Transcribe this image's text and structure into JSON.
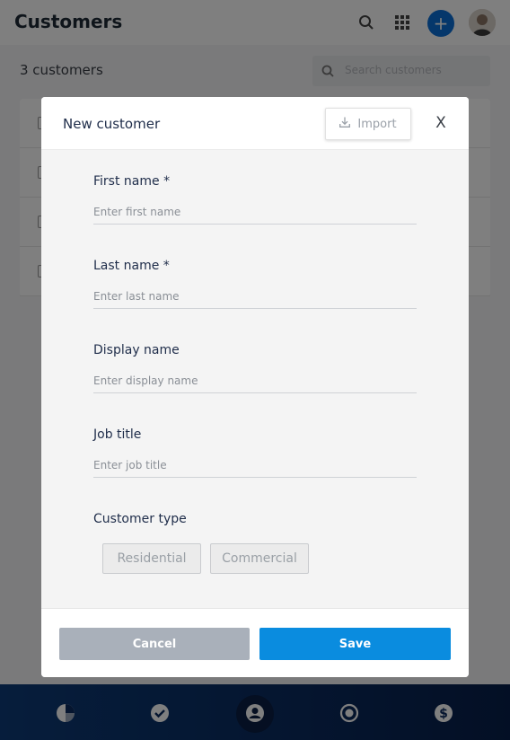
{
  "app": {
    "title": "Customers",
    "customer_count": "3 customers",
    "search_placeholder": "Search customers",
    "add_label": "+"
  },
  "bottom_nav": {
    "items": [
      {
        "icon": "pie-chart-icon"
      },
      {
        "icon": "check-circle-icon"
      },
      {
        "icon": "person-circle-icon",
        "active": true
      },
      {
        "icon": "radio-target-icon"
      },
      {
        "icon": "dollar-circle-icon"
      }
    ]
  },
  "modal": {
    "title": "New customer",
    "import_label": "Import",
    "close_label": "X",
    "fields": [
      {
        "label": "First name *",
        "placeholder": "Enter first name"
      },
      {
        "label": "Last name *",
        "placeholder": "Enter last name"
      },
      {
        "label": "Display name",
        "placeholder": "Enter display name"
      },
      {
        "label": "Job title",
        "placeholder": "Enter job title"
      }
    ],
    "customer_type": {
      "label": "Customer type",
      "options": [
        "Residential",
        "Commercial"
      ]
    },
    "cancel_label": "Cancel",
    "save_label": "Save"
  },
  "colors": {
    "accent": "#0a8cdf",
    "add_button": "#0b6fd6",
    "nav_bar": "#0a2a5e"
  }
}
